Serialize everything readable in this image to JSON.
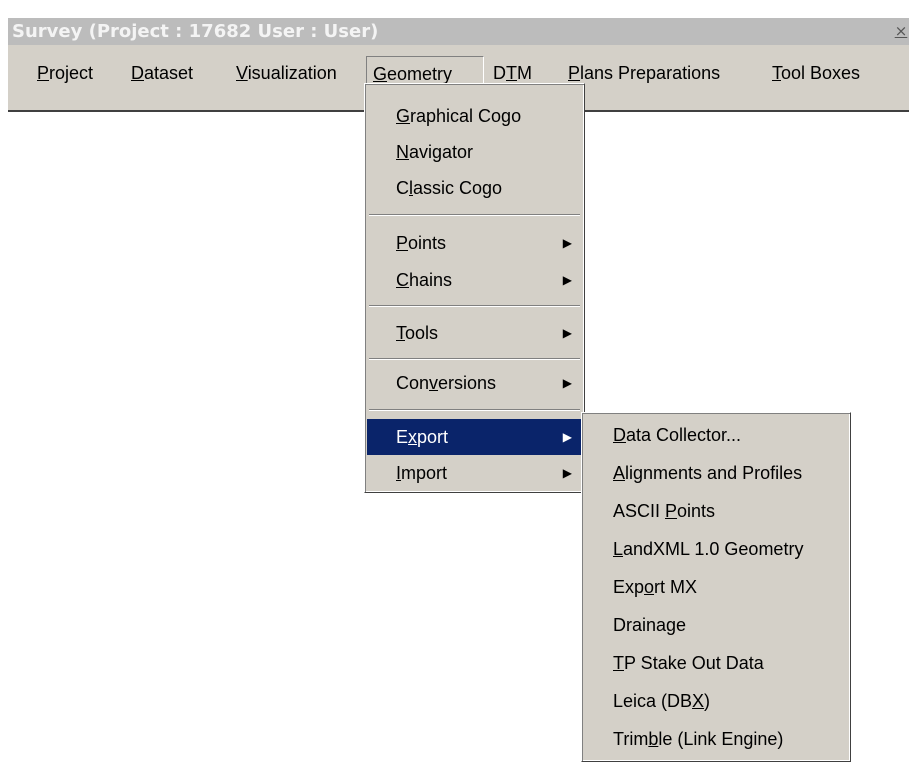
{
  "window": {
    "title": "Survey (Project : 17682  User : User)",
    "close_glyph": "×"
  },
  "menubar": [
    {
      "pre": "",
      "key": "P",
      "post": "roject"
    },
    {
      "pre": "",
      "key": "D",
      "post": "ataset"
    },
    {
      "pre": "",
      "key": "V",
      "post": "isualization"
    },
    {
      "pre": "",
      "key": "G",
      "post": "eometry"
    },
    {
      "pre": "D",
      "key": "T",
      "post": "M"
    },
    {
      "pre": "",
      "key": "P",
      "post": "lans Preparations"
    },
    {
      "pre": "",
      "key": "T",
      "post": "ool Boxes"
    }
  ],
  "geometry_menu": [
    {
      "pre": "",
      "key": "G",
      "post": "raphical Cogo"
    },
    {
      "pre": "",
      "key": "N",
      "post": "avigator"
    },
    {
      "pre": "C",
      "key": "l",
      "post": "assic Cogo"
    },
    {
      "pre": "",
      "key": "P",
      "post": "oints"
    },
    {
      "pre": "",
      "key": "C",
      "post": "hains"
    },
    {
      "pre": "",
      "key": "T",
      "post": "ools"
    },
    {
      "pre": "Con",
      "key": "v",
      "post": "ersions"
    },
    {
      "pre": "E",
      "key": "x",
      "post": "port"
    },
    {
      "pre": "",
      "key": "I",
      "post": "mport"
    }
  ],
  "export_menu": [
    {
      "pre": "",
      "key": "D",
      "post": "ata Collector..."
    },
    {
      "pre": "",
      "key": "A",
      "post": "lignments and Profiles"
    },
    {
      "pre": "ASCII ",
      "key": "P",
      "post": "oints"
    },
    {
      "pre": "",
      "key": "L",
      "post": "andXML 1.0 Geometry"
    },
    {
      "pre": "Exp",
      "key": "o",
      "post": "rt MX"
    },
    {
      "pre": "Draina",
      "key": "g",
      "post": "e"
    },
    {
      "pre": "",
      "key": "T",
      "post": "P Stake Out Data"
    },
    {
      "pre": "Leica (DB",
      "key": "X",
      "post": ")"
    },
    {
      "pre": "Trim",
      "key": "b",
      "post": "le (Link Engine)"
    }
  ],
  "icons": {
    "submenu_arrow": "▶"
  }
}
